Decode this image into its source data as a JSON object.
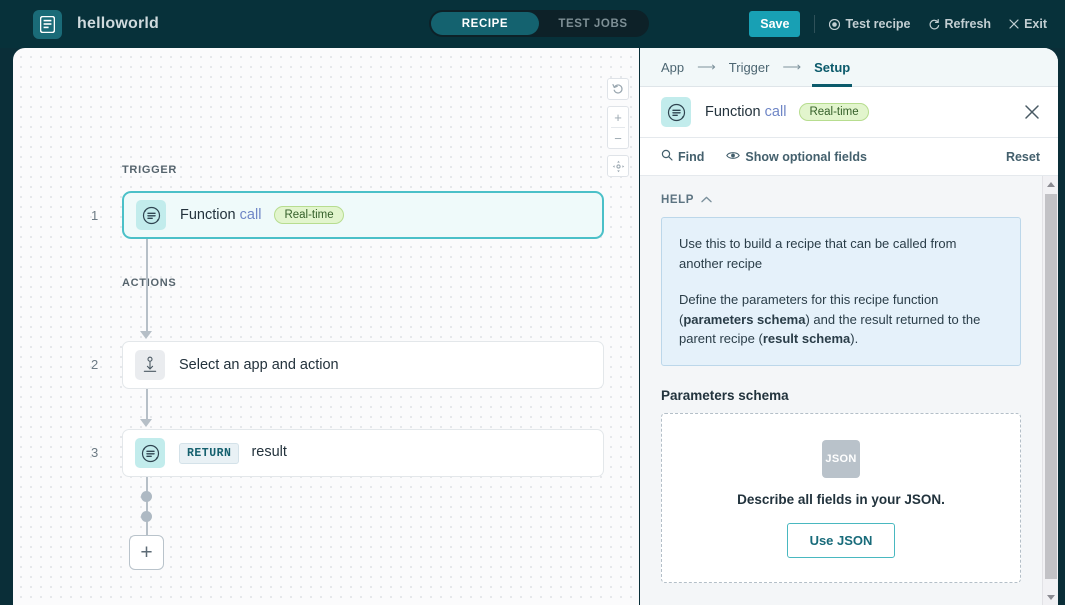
{
  "topbar": {
    "brand_title": "helloworld",
    "logo_icon": "recipe-document-icon",
    "mode_tabs": [
      {
        "label": "RECIPE",
        "active": true
      },
      {
        "label": "TEST JOBS",
        "active": false
      }
    ],
    "save_label": "Save",
    "actions": [
      {
        "label": "Test recipe",
        "icon": "play-circle-icon"
      },
      {
        "label": "Refresh",
        "icon": "refresh-icon"
      },
      {
        "label": "Exit",
        "icon": "close-x-icon"
      }
    ]
  },
  "canvas": {
    "zoom_controls": {
      "reset_icon": "undo-circle-icon",
      "zoom_in_label": "+",
      "zoom_out_label": "−",
      "fit_icon": "fit-to-screen-icon"
    },
    "trigger_label": "TRIGGER",
    "actions_label": "ACTIONS",
    "steps": [
      {
        "number": "1",
        "title": "Function",
        "subtitle": "call",
        "badge": "Real-time",
        "icon": "recipe-function-icon",
        "selected": true
      },
      {
        "number": "2",
        "title": "Select an app and action",
        "icon": "insert-action-icon",
        "selected": false
      },
      {
        "number": "3",
        "chip": "RETURN",
        "title": "result",
        "icon": "recipe-function-icon",
        "selected": false
      }
    ],
    "add_step_label": "+"
  },
  "panel": {
    "breadcrumb": [
      {
        "label": "App",
        "active": false
      },
      {
        "label": "Trigger",
        "active": false
      },
      {
        "label": "Setup",
        "active": true
      }
    ],
    "breadcrumb_arrow": "⟶",
    "header": {
      "title": "Function",
      "subtitle": "call",
      "badge": "Real-time",
      "icon": "recipe-function-icon",
      "close_icon": "close-x-icon"
    },
    "tools": {
      "find_label": "Find",
      "find_icon": "search-icon",
      "optional_label": "Show optional fields",
      "optional_icon": "eye-icon",
      "reset_label": "Reset"
    },
    "help": {
      "section_label": "HELP",
      "collapse_icon": "chevron-up-icon",
      "paragraph_1": "Use this to build a recipe that can be called from another recipe",
      "paragraph_2_a": "Define the parameters for this recipe function (",
      "paragraph_2_bold_1": "parameters schema",
      "paragraph_2_b": ") and the result returned to the parent recipe (",
      "paragraph_2_bold_2": "result schema",
      "paragraph_2_c": ")."
    },
    "parameters_schema": {
      "title": "Parameters schema",
      "icon_label": "JSON",
      "description": "Describe all fields in your JSON.",
      "button_label": "Use JSON"
    }
  },
  "colors": {
    "brand_dark": "#07313a",
    "accent_teal": "#18a0b4",
    "trigger_border": "#4bc0c8",
    "badge_green_bg": "#e2f5cd",
    "help_box_bg": "#e5f1fa"
  }
}
